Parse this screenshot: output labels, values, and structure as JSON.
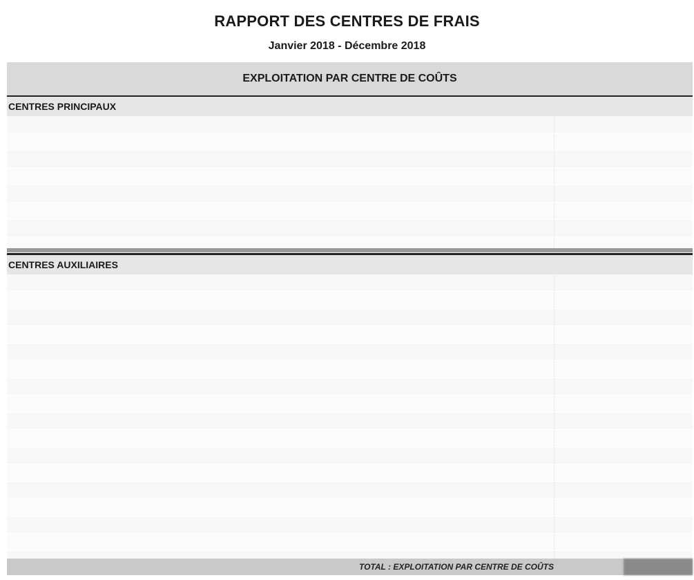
{
  "report": {
    "title": "RAPPORT DES CENTRES DE FRAIS",
    "period": "Janvier 2018 - Décembre 2018",
    "section_title": "EXPLOITATION PAR CENTRE DE COÛTS"
  },
  "groups": {
    "principal": {
      "title": "CENTRES PRINCIPAUX",
      "rows": [
        {
          "label": "",
          "amount": ""
        },
        {
          "label": "",
          "amount": ""
        },
        {
          "label": "",
          "amount": ""
        },
        {
          "label": "",
          "amount": ""
        },
        {
          "label": "",
          "amount": ""
        },
        {
          "label": "",
          "amount": ""
        },
        {
          "label": "",
          "amount": ""
        },
        {
          "label": "",
          "amount": ""
        }
      ]
    },
    "auxiliaire": {
      "title": "CENTRES AUXILIAIRES",
      "rows": [
        {
          "label": "",
          "amount": ""
        },
        {
          "label": "",
          "amount": ""
        },
        {
          "label": "",
          "amount": ""
        },
        {
          "label": "",
          "amount": ""
        },
        {
          "label": "",
          "amount": ""
        },
        {
          "label": "",
          "amount": ""
        },
        {
          "label": "",
          "amount": ""
        },
        {
          "label": "",
          "amount": ""
        },
        {
          "label": "",
          "amount": ""
        },
        {
          "label": "",
          "amount": ""
        },
        {
          "label": "",
          "amount": ""
        },
        {
          "label": "",
          "amount": ""
        },
        {
          "label": "",
          "amount": ""
        },
        {
          "label": "",
          "amount": ""
        },
        {
          "label": "",
          "amount": ""
        },
        {
          "label": "",
          "amount": ""
        },
        {
          "label": "",
          "amount": ""
        }
      ]
    }
  },
  "total": {
    "label": "TOTAL : EXPLOITATION PAR CENTRE DE COÛTS",
    "amount": ""
  }
}
